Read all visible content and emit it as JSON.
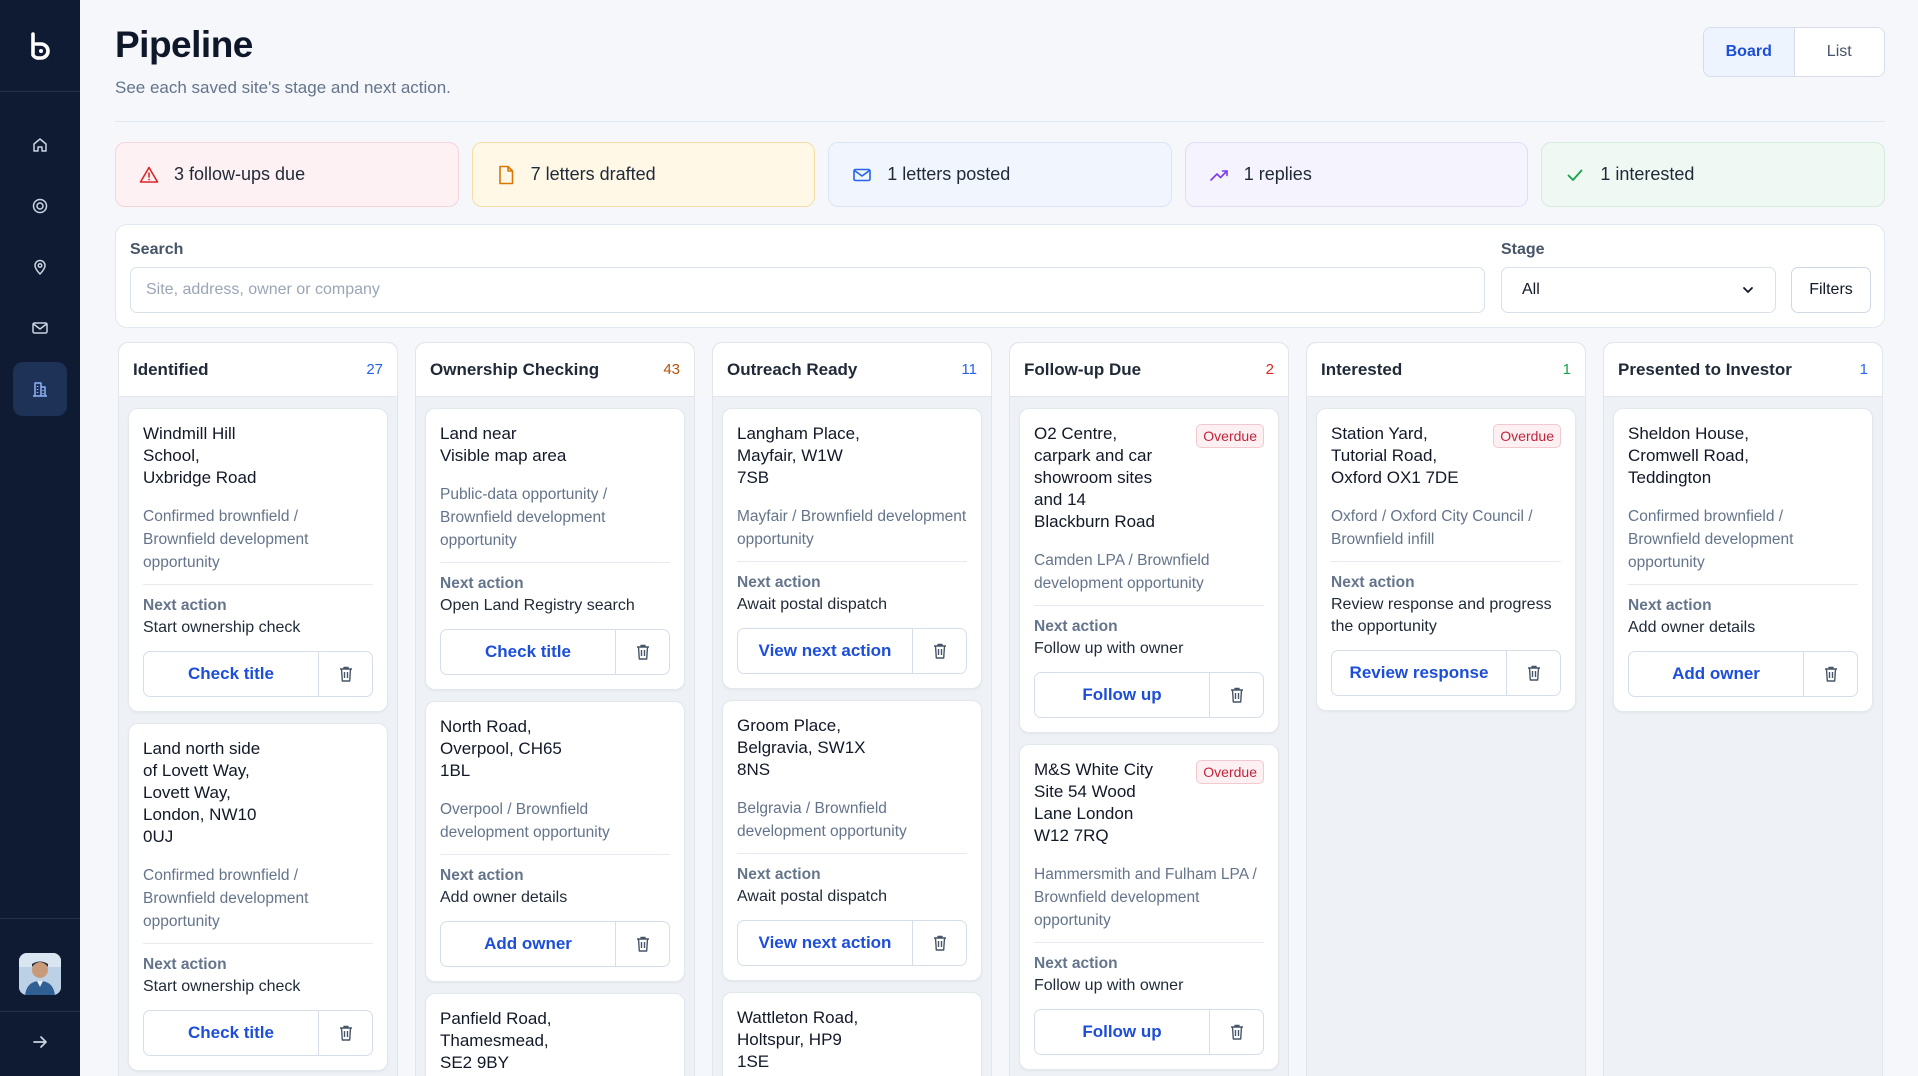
{
  "app": {
    "logo_icon": "b-logo-icon"
  },
  "sidebar": {
    "items": [
      {
        "icon": "home-icon",
        "active": false
      },
      {
        "icon": "target-icon",
        "active": false
      },
      {
        "icon": "map-pin-icon",
        "active": false
      },
      {
        "icon": "mail-icon",
        "active": false
      },
      {
        "icon": "building-icon",
        "active": true
      }
    ],
    "collapse_icon": "arrow-right-icon"
  },
  "header": {
    "title": "Pipeline",
    "subtitle": "See each saved site's stage and next action.",
    "view_toggle": {
      "board": "Board",
      "list": "List",
      "selected": "Board"
    }
  },
  "stats": [
    {
      "icon": "warning-icon",
      "label": "3 follow-ups due",
      "color": "#dc2626"
    },
    {
      "icon": "document-icon",
      "label": "7 letters drafted",
      "color": "#d97706"
    },
    {
      "icon": "mail-icon",
      "label": "1 letters posted",
      "color": "#2563eb"
    },
    {
      "icon": "trending-up-icon",
      "label": "1 replies",
      "color": "#7c3aed"
    },
    {
      "icon": "check-icon",
      "label": "1 interested",
      "color": "#16a34a"
    }
  ],
  "filters": {
    "search_label": "Search",
    "search_placeholder": "Site, address, owner or company",
    "stage_label": "Stage",
    "stage_value": "All",
    "filters_button": "Filters"
  },
  "columns": [
    {
      "title": "Identified",
      "count": "27",
      "count_color": "#2563eb",
      "cards": [
        {
          "title": "Windmill Hill\nSchool,\nUxbridge Road",
          "badge": "",
          "meta": "Confirmed brownfield / Brownfield development opportunity",
          "next_action_label": "Next action",
          "next_action": "Start ownership check",
          "action": "Check title"
        },
        {
          "title": "Land north side\nof Lovett Way,\nLovett Way,\nLondon, NW10\n0UJ",
          "badge": "",
          "meta": "Confirmed brownfield / Brownfield development opportunity",
          "next_action_label": "Next action",
          "next_action": "Start ownership check",
          "action": "Check title"
        }
      ]
    },
    {
      "title": "Ownership Checking",
      "count": "43",
      "count_color": "#b45309",
      "cards": [
        {
          "title": "Land near\nVisible map area",
          "badge": "",
          "meta": "Public-data opportunity / Brownfield development opportunity",
          "next_action_label": "Next action",
          "next_action": "Open Land Registry search",
          "action": "Check title"
        },
        {
          "title": "North Road,\nOverpool, CH65\n1BL",
          "badge": "",
          "meta": "Overpool / Brownfield development opportunity",
          "next_action_label": "Next action",
          "next_action": "Add owner details",
          "action": "Add owner"
        },
        {
          "title": "Panfield Road,\nThamesmead,\nSE2 9BY",
          "badge": "",
          "meta": "",
          "next_action_label": "",
          "next_action": "",
          "action": ""
        }
      ]
    },
    {
      "title": "Outreach Ready",
      "count": "11",
      "count_color": "#2563eb",
      "cards": [
        {
          "title": "Langham Place,\nMayfair, W1W\n7SB",
          "badge": "",
          "meta": "Mayfair / Brownfield development opportunity",
          "next_action_label": "Next action",
          "next_action": "Await postal dispatch",
          "action": "View next action"
        },
        {
          "title": "Groom Place,\nBelgravia, SW1X\n8NS",
          "badge": "",
          "meta": "Belgravia / Brownfield development opportunity",
          "next_action_label": "Next action",
          "next_action": "Await postal dispatch",
          "action": "View next action"
        },
        {
          "title": "Wattleton Road,\nHoltspur, HP9\n1SE",
          "badge": "",
          "meta": "",
          "next_action_label": "",
          "next_action": "",
          "action": ""
        }
      ]
    },
    {
      "title": "Follow-up Due",
      "count": "2",
      "count_color": "#dc2626",
      "cards": [
        {
          "title": "O2 Centre,\ncarpark and car\nshowroom sites\nand 14\nBlackburn Road",
          "badge": "Overdue",
          "meta": "Camden LPA / Brownfield development opportunity",
          "next_action_label": "Next action",
          "next_action": "Follow up with owner",
          "action": "Follow up"
        },
        {
          "title": "M&S White City\nSite 54 Wood\nLane London\nW12 7RQ",
          "badge": "Overdue",
          "meta": "Hammersmith and Fulham LPA / Brownfield development opportunity",
          "next_action_label": "Next action",
          "next_action": "Follow up with owner",
          "action": "Follow up"
        }
      ]
    },
    {
      "title": "Interested",
      "count": "1",
      "count_color": "#16a34a",
      "cards": [
        {
          "title": "Station Yard,\nTutorial Road,\nOxford OX1 7DE",
          "badge": "Overdue",
          "meta": "Oxford / Oxford City Council / Brownfield infill",
          "next_action_label": "Next action",
          "next_action": "Review response and progress the opportunity",
          "action": "Review response"
        }
      ]
    },
    {
      "title": "Presented to Investor",
      "count": "1",
      "count_color": "#2563eb",
      "cards": [
        {
          "title": "Sheldon House,\nCromwell Road,\nTeddington",
          "badge": "",
          "meta": "Confirmed brownfield / Brownfield development opportunity",
          "next_action_label": "Next action",
          "next_action": "Add owner details",
          "action": "Add owner"
        }
      ]
    }
  ]
}
